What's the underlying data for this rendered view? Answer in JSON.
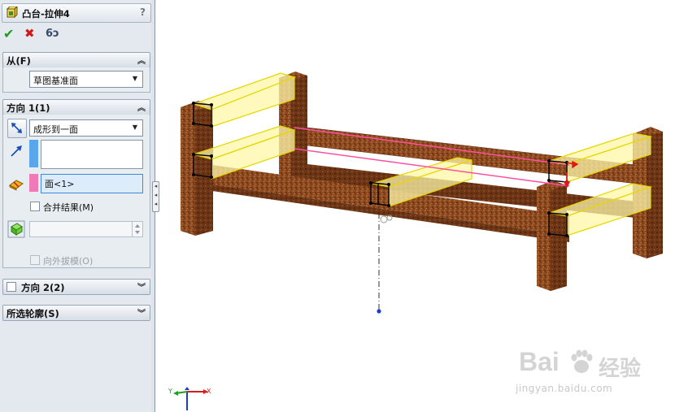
{
  "feature": {
    "title": "凸台-拉伸4",
    "help": "?",
    "ok_icon": "✔",
    "cancel_icon": "✖",
    "preview_icon": "6ɔ"
  },
  "from": {
    "header": "从(F)",
    "start_condition": "草图基准面",
    "dropdown_arrow": "▼"
  },
  "direction1": {
    "header": "方向 1(1)",
    "end_condition": "成形到一面",
    "dropdown_arrow": "▼",
    "face_value": "面<1>",
    "merge_label": "合并结果(M)",
    "merge_checked": false,
    "draft_label": "向外拔模(O)"
  },
  "direction2": {
    "header": "方向 2(2)",
    "checked": false
  },
  "contours": {
    "header": "所选轮廓(S)"
  },
  "chevrons": {
    "up": "︽",
    "down": "︾"
  },
  "splitter_arrows": "◂",
  "triad": {
    "x": "X",
    "y": "Y"
  },
  "watermark": {
    "brand": "Bai",
    "brand2": "经验",
    "url": "jingyan.baidu.com"
  },
  "colors": {
    "panel_bg": "#e4e9ef",
    "wood": "#8b4a22",
    "preview_fill": "#fff8a0",
    "preview_edge": "#e8d800",
    "selected_edge": "#ff4fa0",
    "accent_blue": "#5aa6ec",
    "accent_pink": "#f07ab8"
  }
}
